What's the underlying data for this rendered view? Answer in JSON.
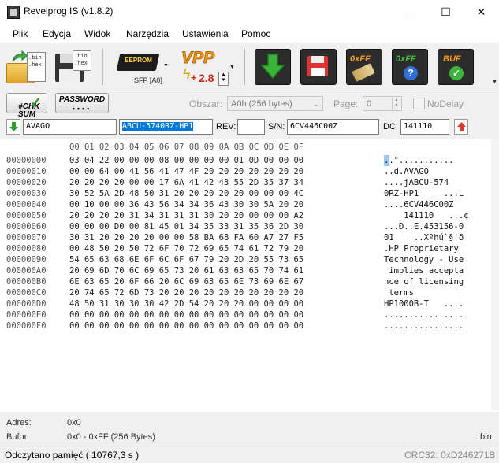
{
  "window": {
    "title": "Revelprog IS (v1.8.2)",
    "minimize": "—",
    "maximize": "☐",
    "close": "✕"
  },
  "menu": [
    "Plik",
    "Edycja",
    "Widok",
    "Narzędzia",
    "Ustawienia",
    "Pomoc"
  ],
  "toolbar": {
    "open_icon_text": ".bin\n.hex",
    "save_icon_text": ".bin\n.hex",
    "chip_label": "EEPROM",
    "chip_package": "SFP [A0]",
    "vpp_label": "VPP",
    "vpp_value": "2.8",
    "erase_label": "0xFF",
    "verify_label": "0xFF",
    "buf_label": "BUF"
  },
  "row2": {
    "chksum_label": "#CHK\nSUM",
    "password_label": "PASSWORD",
    "password_mask": "••••",
    "area_label": "Obszar:",
    "area_value": "A0h (256 bytes)",
    "page_label": "Page:",
    "page_value": "0",
    "nodelay_label": "NoDelay"
  },
  "fields": {
    "vendor": "AVAGO",
    "part": "ABCU-5740RZ-HP1",
    "rev_label": "REV:",
    "rev": "",
    "sn_label": "S/N:",
    "sn": "6CV446C00Z",
    "dc_label": "DC:",
    "dc": "141110"
  },
  "hex": {
    "header": "00 01 02 03 04 05 06 07 08 09 0A 0B 0C 0D 0E 0F",
    "offsets": [
      "00000000",
      "00000010",
      "00000020",
      "00000030",
      "00000040",
      "00000050",
      "00000060",
      "00000070",
      "00000080",
      "00000090",
      "000000A0",
      "000000B0",
      "000000C0",
      "000000D0",
      "000000E0",
      "000000F0"
    ],
    "rows": [
      "03 04 22 00 00 00 08 00 00 00 00 01 0D 00 00 00",
      "00 00 64 00 41 56 41 47 4F 20 20 20 20 20 20 20",
      "20 20 20 20 00 00 17 6A 41 42 43 55 2D 35 37 34",
      "30 52 5A 2D 48 50 31 20 20 20 20 20 00 00 00 4C",
      "00 10 00 00 36 43 56 34 34 36 43 30 30 5A 20 20",
      "20 20 20 20 31 34 31 31 31 30 20 20 00 00 00 A2",
      "00 00 00 D0 00 81 45 01 34 35 33 31 35 36 2D 30",
      "30 31 20 20 20 20 00 00 58 BA 68 FA 60 A7 27 F5",
      "00 48 50 20 50 72 6F 70 72 69 65 74 61 72 79 20",
      "54 65 63 68 6E 6F 6C 6F 67 79 20 2D 20 55 73 65",
      "20 69 6D 70 6C 69 65 73 20 61 63 63 65 70 74 61",
      "6E 63 65 20 6F 66 20 6C 69 63 65 6E 73 69 6E 67",
      "20 74 65 72 6D 73 20 20 20 20 20 20 20 20 20 20",
      "48 50 31 30 30 30 42 2D 54 20 20 20 00 00 00 00",
      "00 00 00 00 00 00 00 00 00 00 00 00 00 00 00 00",
      "00 00 00 00 00 00 00 00 00 00 00 00 00 00 00 00"
    ],
    "ascii": [
      "..\"...........",
      "..d.AVAGO",
      "....jABCU-574",
      "0RZ-HP1     ...L",
      "....6CV446C00Z",
      "    141110   ...¢",
      "...Ð..E.453156-0",
      "01    ..Xºhú`§'õ",
      ".HP Proprietary",
      "Technology - Use",
      " implies accepta",
      "nce of licensing",
      " terms",
      "HP1000B-T   ....",
      "................",
      "................"
    ]
  },
  "status": {
    "adres_label": "Adres:",
    "adres_value": "0x0",
    "bufor_label": "Bufor:",
    "bufor_value": "0x0 - 0xFF (256 Bytes)",
    "file_ext": ".bin",
    "message": "Odczytano pamięć ( 10767,3 s )",
    "crc": "CRC32: 0xD246271B"
  },
  "colors": {
    "selection": "#0078d7",
    "download_green": "#2e9d2e",
    "upload_red": "#d9382b",
    "vpp_orange": "#f39a1d"
  }
}
